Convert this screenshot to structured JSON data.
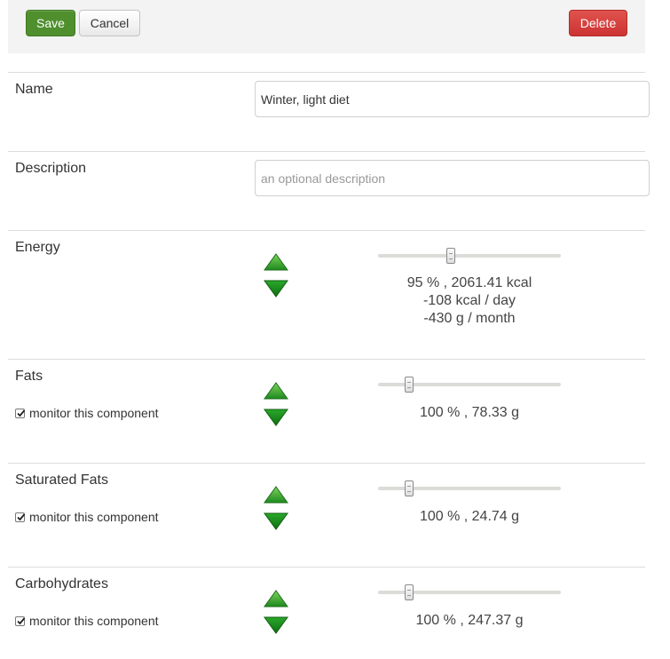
{
  "toolbar": {
    "save_label": "Save",
    "cancel_label": "Cancel",
    "delete_label": "Delete"
  },
  "colors": {
    "save": "#4f8f2e",
    "delete": "#cc3333",
    "arrow_green": "#2e9d2a"
  },
  "name_field": {
    "label": "Name",
    "value": "Winter, light diet"
  },
  "description_field": {
    "label": "Description",
    "value": "",
    "placeholder": "an optional description"
  },
  "components": [
    {
      "label": "Energy",
      "slider_level_percent": 40,
      "readout": [
        "95 % , 2061.41 kcal",
        "-108 kcal / day",
        "-430 g / month"
      ]
    },
    {
      "label": "Fats",
      "monitor_label": "monitor this component",
      "monitor_checked": true,
      "slider_level_percent": 17,
      "readout": [
        "100 % , 78.33 g"
      ]
    },
    {
      "label": "Saturated Fats",
      "monitor_label": "monitor this component",
      "monitor_checked": true,
      "slider_level_percent": 17,
      "readout": [
        "100 % , 24.74 g"
      ]
    },
    {
      "label": "Carbohydrates",
      "monitor_label": "monitor this component",
      "monitor_checked": true,
      "slider_level_percent": 17,
      "readout": [
        "100 % , 247.37 g"
      ]
    }
  ]
}
